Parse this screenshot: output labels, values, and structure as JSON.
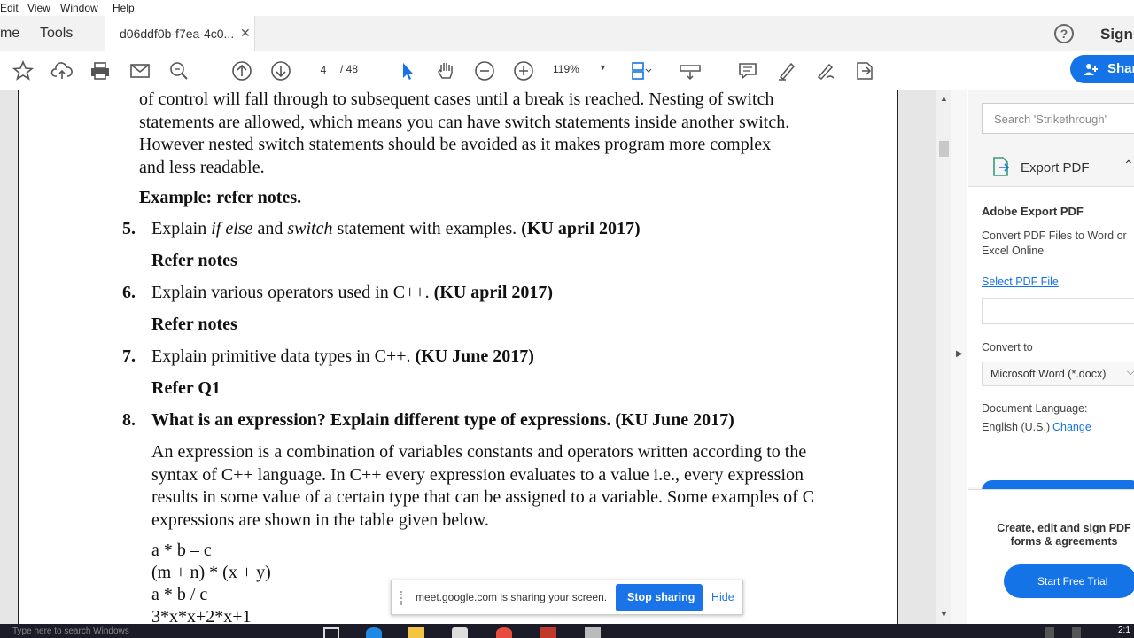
{
  "menu": {
    "items": [
      "Edit",
      "View",
      "Window",
      "Help"
    ]
  },
  "tabs": {
    "home": "me",
    "tools": "Tools",
    "document": "d06ddf0b-f7ea-4c0...",
    "close": "✕"
  },
  "header": {
    "help": "?",
    "sign_in": "Sign"
  },
  "toolbar": {
    "page_current": "4",
    "page_total": "/ 48",
    "zoom": "119%",
    "share": "Shar"
  },
  "document": {
    "para1": "of control will fall through to subsequent cases until a break is reached. Nesting of switch statements are allowed, which means you can have switch statements inside another switch. However nested switch statements should be avoided as it makes program more complex and less readable.",
    "example": "Example: refer notes.",
    "q5": {
      "num": "5.",
      "pre": "Explain ",
      "kw1": "if else",
      "mid": " and ",
      "kw2": "switch",
      "post": " statement with examples. ",
      "ref": "(KU april 2017)"
    },
    "q5_answer": "Refer notes",
    "q6": {
      "num": "6.",
      "text": "Explain various operators used in C++. ",
      "ref": "(KU april 2017)"
    },
    "q6_answer": "Refer notes",
    "q7": {
      "num": "7.",
      "text": "Explain primitive data types in C++. ",
      "ref": "(KU June 2017)"
    },
    "q7_answer": "Refer Q1",
    "q8": {
      "num": "8.",
      "text": "What is an expression? Explain different type of expressions. (KU June 2017)"
    },
    "q8_body": "An expression is a combination of variables constants and operators written according to the syntax of C++ language. In C++ every expression evaluates to a value i.e., every expression results in some value of a certain type that can be assigned to a variable. Some examples of C expressions are shown in the table given below.",
    "examples": [
      "a * b – c",
      "(m + n) * (x + y)",
      "a * b / c",
      "3*x*x+2*x+1"
    ]
  },
  "right_panel": {
    "search_placeholder": "Search 'Strikethrough'",
    "export_label": "Export PDF",
    "title": "Adobe Export PDF",
    "description": "Convert PDF Files to Word or Excel Online",
    "select_link": "Select PDF File",
    "convert_to_label": "Convert to",
    "convert_to_value": "Microsoft Word (*.docx)",
    "language_label": "Document Language:",
    "language_value": "English (U.S.)",
    "change_link": "Change",
    "promo_text": "Create, edit and sign PDF forms & agreements",
    "trial_button": "Start Free Trial"
  },
  "share_bar": {
    "message": "meet.google.com is sharing your screen.",
    "stop": "Stop sharing",
    "hide": "Hide"
  },
  "taskbar": {
    "clock": "2:1",
    "faded_text": "Type here to search Windows"
  },
  "colors": {
    "accent": "#1473e6",
    "meet_blue": "#1a73e8",
    "taskbar": "#1c1c28"
  }
}
